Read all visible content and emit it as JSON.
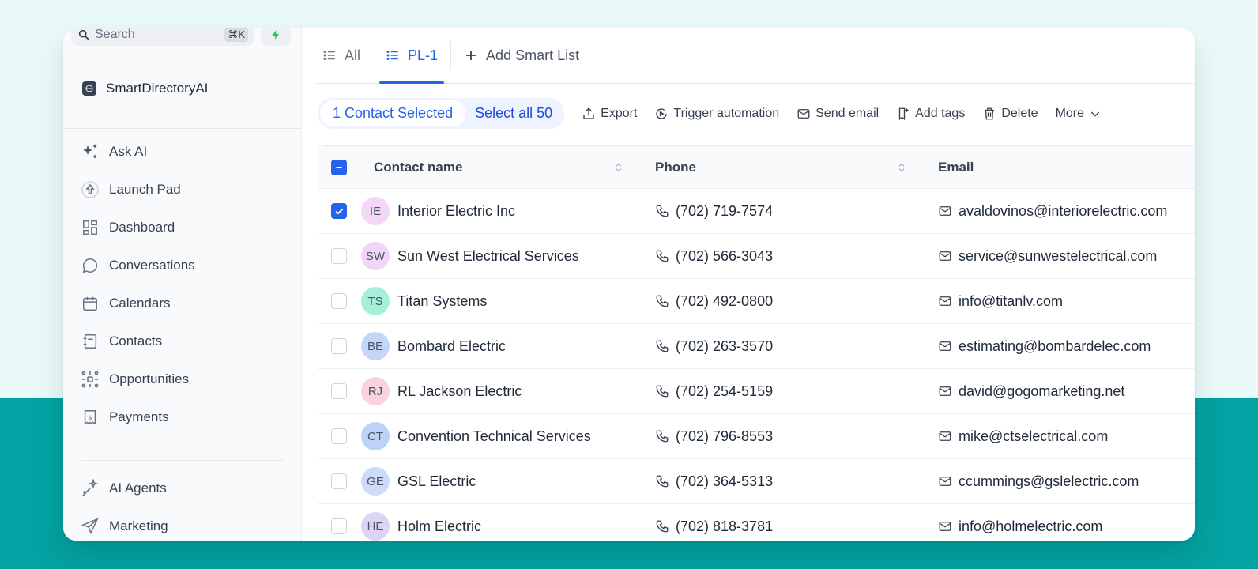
{
  "search": {
    "placeholder": "Search",
    "shortcut": "⌘K"
  },
  "workspace": {
    "name": "SmartDirectoryAI"
  },
  "sidebar": {
    "items": [
      {
        "label": "Ask AI",
        "icon": "sparkles-icon"
      },
      {
        "label": "Launch Pad",
        "icon": "rocket-icon"
      },
      {
        "label": "Dashboard",
        "icon": "grid-icon"
      },
      {
        "label": "Conversations",
        "icon": "chat-bubble-icon"
      },
      {
        "label": "Calendars",
        "icon": "calendar-icon"
      },
      {
        "label": "Contacts",
        "icon": "address-book-icon"
      },
      {
        "label": "Opportunities",
        "icon": "opportunities-icon"
      },
      {
        "label": "Payments",
        "icon": "receipt-icon"
      }
    ],
    "items2": [
      {
        "label": "AI Agents",
        "icon": "ai-agents-icon"
      },
      {
        "label": "Marketing",
        "icon": "send-icon"
      }
    ]
  },
  "tabs": [
    {
      "label": "All"
    },
    {
      "label": "PL-1"
    }
  ],
  "add_smart_list": "Add Smart List",
  "toolbar": {
    "selected": "1 Contact Selected",
    "select_all": "Select all 50",
    "export": "Export",
    "trigger": "Trigger automation",
    "send_email": "Send email",
    "add_tags": "Add tags",
    "delete": "Delete",
    "more": "More"
  },
  "table": {
    "headers": {
      "name": "Contact name",
      "phone": "Phone",
      "email": "Email"
    },
    "rows": [
      {
        "initials": "IE",
        "name": "Interior Electric Inc",
        "phone": "(702) 719-7574",
        "email": "avaldovinos@interiorelectric.com",
        "checked": true,
        "color": "#f3d7f7"
      },
      {
        "initials": "SW",
        "name": "Sun West Electrical Services",
        "phone": "(702) 566-3043",
        "email": "service@sunwestelectrical.com",
        "checked": false,
        "color": "#efd6f7"
      },
      {
        "initials": "TS",
        "name": "Titan Systems",
        "phone": "(702) 492-0800",
        "email": "info@titanlv.com",
        "checked": false,
        "color": "#a6f0d9"
      },
      {
        "initials": "BE",
        "name": "Bombard Electric",
        "phone": "(702) 263-3570",
        "email": "estimating@bombardelec.com",
        "checked": false,
        "color": "#c3d6f8"
      },
      {
        "initials": "RJ",
        "name": "RL Jackson Electric",
        "phone": "(702) 254-5159",
        "email": "david@gogomarketing.net",
        "checked": false,
        "color": "#fbd3de"
      },
      {
        "initials": "CT",
        "name": "Convention Technical Services",
        "phone": "(702) 796-8553",
        "email": "mike@ctselectrical.com",
        "checked": false,
        "color": "#bcd2f7"
      },
      {
        "initials": "GE",
        "name": "GSL Electric",
        "phone": "(702) 364-5313",
        "email": "ccummings@gslelectric.com",
        "checked": false,
        "color": "#cddbf8"
      },
      {
        "initials": "HE",
        "name": "Holm Electric",
        "phone": "(702) 818-3781",
        "email": "info@holmelectric.com",
        "checked": false,
        "color": "#dcd3f5"
      }
    ]
  },
  "colors": {
    "accent": "#2563eb",
    "band": "#04a2a2",
    "background": "#eafafa"
  }
}
